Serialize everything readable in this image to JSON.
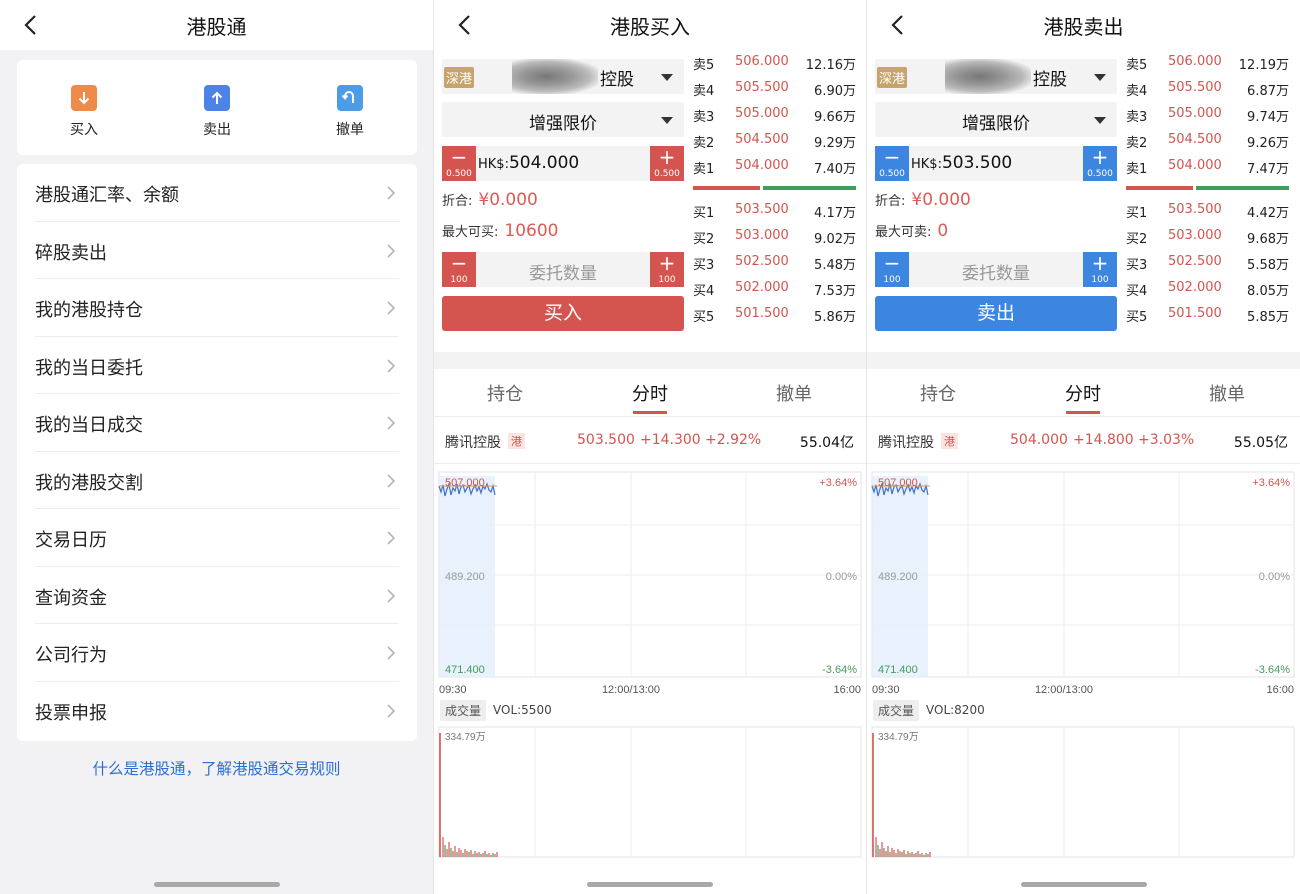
{
  "colors": {
    "red": "#d4554f",
    "green": "#3f9e5b",
    "blue": "#3d86e0",
    "link": "#2a6fd1"
  },
  "panel1": {
    "title": "港股通",
    "actions": [
      {
        "label": "买入",
        "icon": "arrow-down-icon",
        "color": "#f08a4b"
      },
      {
        "label": "卖出",
        "icon": "arrow-up-icon",
        "color": "#4d83e8"
      },
      {
        "label": "撤单",
        "icon": "undo-icon",
        "color": "#4d9ce8"
      }
    ],
    "menu": [
      "港股通汇率、余额",
      "碎股卖出",
      "我的港股持仓",
      "我的当日委托",
      "我的当日成交",
      "我的港股交割",
      "交易日历",
      "查询资金",
      "公司行为",
      "投票申报"
    ],
    "link": "什么是港股通，了解港股通交易规则"
  },
  "panel2": {
    "title": "港股买入",
    "market_tag": "深港",
    "stock_suffix": "控股",
    "order_type": "增强限价",
    "price_currency": "HK$:",
    "price": "504.000",
    "step_price": "0.500",
    "fold_label": "折合:",
    "fold_value": "¥0.000",
    "max_label": "最大可买:",
    "max_value": "10600",
    "qty_placeholder": "委托数量",
    "step_qty": "100",
    "submit": "买入",
    "asks": [
      {
        "label": "卖5",
        "price": "506.000",
        "qty": "12.16万"
      },
      {
        "label": "卖4",
        "price": "505.500",
        "qty": "6.90万"
      },
      {
        "label": "卖3",
        "price": "505.000",
        "qty": "9.66万"
      },
      {
        "label": "卖2",
        "price": "504.500",
        "qty": "9.29万"
      },
      {
        "label": "卖1",
        "price": "504.000",
        "qty": "7.40万"
      }
    ],
    "bids": [
      {
        "label": "买1",
        "price": "503.500",
        "qty": "4.17万"
      },
      {
        "label": "买2",
        "price": "503.000",
        "qty": "9.02万"
      },
      {
        "label": "买3",
        "price": "502.500",
        "qty": "5.48万"
      },
      {
        "label": "买4",
        "price": "502.000",
        "qty": "7.53万"
      },
      {
        "label": "买5",
        "price": "501.500",
        "qty": "5.86万"
      }
    ],
    "tabs": [
      "持仓",
      "分时",
      "撤单"
    ],
    "quote": {
      "name": "腾讯控股",
      "tag": "港",
      "price": "503.500",
      "change": "+14.300",
      "pct": "+2.92%",
      "turnover": "55.04亿"
    },
    "chart": {
      "top_price": "507.000",
      "mid_price": "489.200",
      "bottom_price": "471.400",
      "top_pct": "+3.64%",
      "mid_pct": "0.00%",
      "bottom_pct": "-3.64%",
      "t_start": "09:30",
      "t_mid": "12:00/13:00",
      "t_end": "16:00",
      "vol_btn": "成交量",
      "vol_text": "VOL:5500",
      "vol_max": "334.79万"
    }
  },
  "panel3": {
    "title": "港股卖出",
    "market_tag": "深港",
    "stock_suffix": "控股",
    "order_type": "增强限价",
    "price_currency": "HK$:",
    "price": "503.500",
    "step_price": "0.500",
    "fold_label": "折合:",
    "fold_value": "¥0.000",
    "max_label": "最大可卖:",
    "max_value": "0",
    "qty_placeholder": "委托数量",
    "step_qty": "100",
    "submit": "卖出",
    "asks": [
      {
        "label": "卖5",
        "price": "506.000",
        "qty": "12.19万"
      },
      {
        "label": "卖4",
        "price": "505.500",
        "qty": "6.87万"
      },
      {
        "label": "卖3",
        "price": "505.000",
        "qty": "9.74万"
      },
      {
        "label": "卖2",
        "price": "504.500",
        "qty": "9.26万"
      },
      {
        "label": "卖1",
        "price": "504.000",
        "qty": "7.47万"
      }
    ],
    "bids": [
      {
        "label": "买1",
        "price": "503.500",
        "qty": "4.42万"
      },
      {
        "label": "买2",
        "price": "503.000",
        "qty": "9.68万"
      },
      {
        "label": "买3",
        "price": "502.500",
        "qty": "5.58万"
      },
      {
        "label": "买4",
        "price": "502.000",
        "qty": "8.05万"
      },
      {
        "label": "买5",
        "price": "501.500",
        "qty": "5.85万"
      }
    ],
    "tabs": [
      "持仓",
      "分时",
      "撤单"
    ],
    "quote": {
      "name": "腾讯控股",
      "tag": "港",
      "price": "504.000",
      "change": "+14.800",
      "pct": "+3.03%",
      "turnover": "55.05亿"
    },
    "chart": {
      "top_price": "507.000",
      "mid_price": "489.200",
      "bottom_price": "471.400",
      "top_pct": "+3.64%",
      "mid_pct": "0.00%",
      "bottom_pct": "-3.64%",
      "t_start": "09:30",
      "t_mid": "12:00/13:00",
      "t_end": "16:00",
      "vol_btn": "成交量",
      "vol_text": "VOL:8200",
      "vol_max": "334.79万"
    }
  }
}
